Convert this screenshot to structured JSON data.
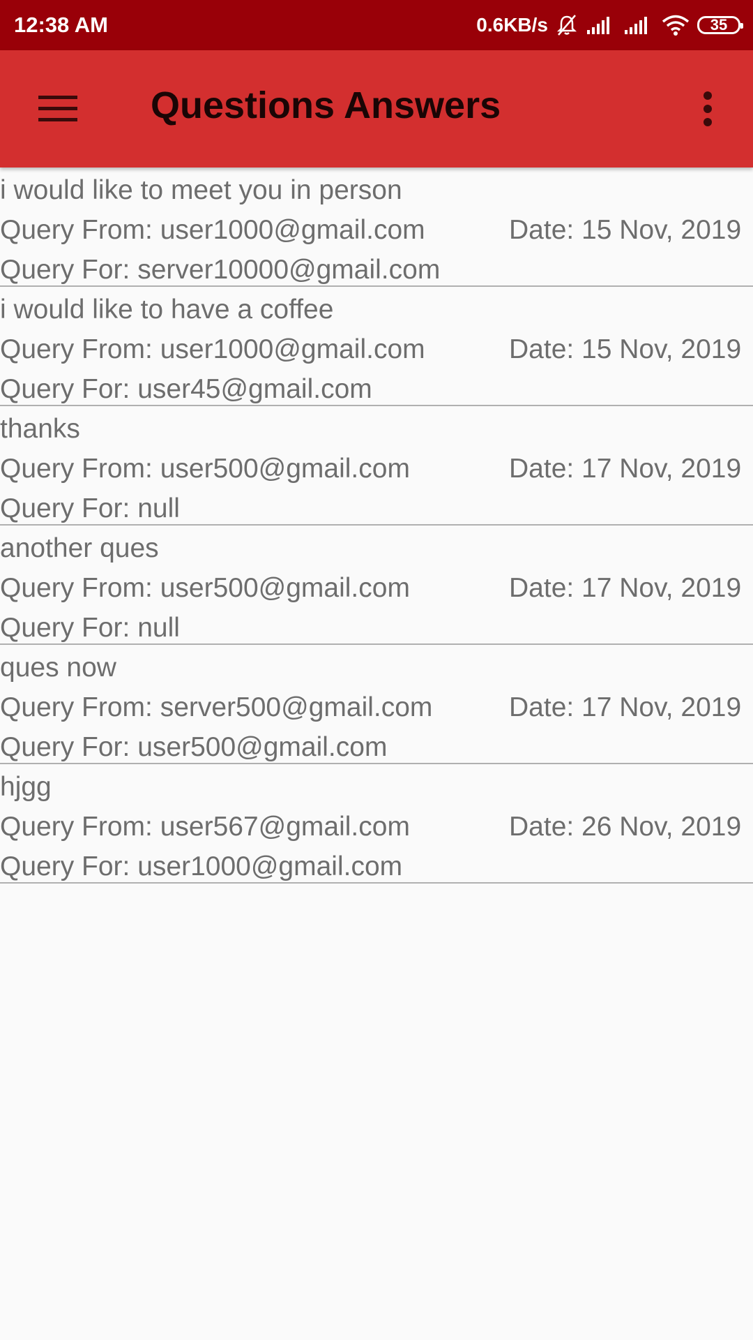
{
  "status_bar": {
    "time": "12:38 AM",
    "network_speed": "0.6KB/s",
    "battery_level": "35",
    "icons": [
      "mute-bell-icon",
      "signal-icon",
      "signal-icon",
      "wifi-icon",
      "battery-icon"
    ]
  },
  "app_bar": {
    "title": "Questions Answers",
    "menu_icon": "hamburger-menu-icon",
    "overflow_icon": "more-vertical-icon",
    "background_color": "#d32f2f",
    "status_color": "#990008"
  },
  "queries": [
    {
      "question": "i would like to meet you in person",
      "from": "Query From: user1000@gmail.com",
      "date": "Date: 15 Nov, 2019",
      "for": "Query For: server10000@gmail.com"
    },
    {
      "question": "i would like to have a coffee",
      "from": "Query From: user1000@gmail.com",
      "date": "Date: 15 Nov, 2019",
      "for": "Query For: user45@gmail.com"
    },
    {
      "question": "thanks",
      "from": "Query From: user500@gmail.com",
      "date": "Date: 17 Nov, 2019",
      "for": "Query For: null"
    },
    {
      "question": "another ques",
      "from": "Query From: user500@gmail.com",
      "date": "Date: 17 Nov, 2019",
      "for": "Query For: null"
    },
    {
      "question": "ques now",
      "from": "Query From: server500@gmail.com",
      "date": "Date: 17 Nov, 2019",
      "for": "Query For: user500@gmail.com"
    },
    {
      "question": "hjgg",
      "from": "Query From: user567@gmail.com",
      "date": "Date: 26 Nov, 2019",
      "for": "Query For: user1000@gmail.com"
    }
  ]
}
